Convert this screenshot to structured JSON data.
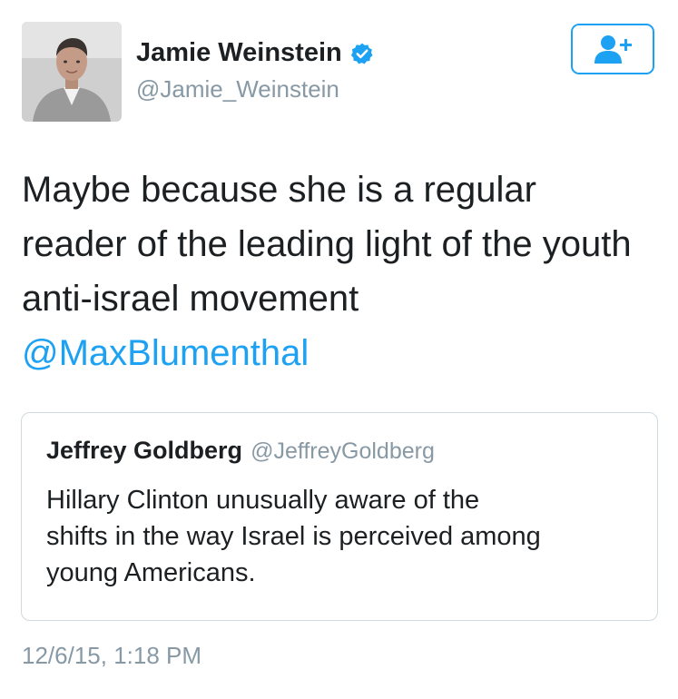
{
  "author": {
    "display_name": "Jamie Weinstein",
    "handle": "@Jamie_Weinstein",
    "verified": true,
    "avatar_icon": "profile-photo"
  },
  "follow_button": {
    "icon": "add-user-icon",
    "color": "#1da1f2"
  },
  "tweet": {
    "text": "Maybe because she is a regular\nreader of the leading light of the youth\nanti-israel movement",
    "mention": "@MaxBlumenthal"
  },
  "quoted_tweet": {
    "display_name": "Jeffrey Goldberg",
    "handle": "@JeffreyGoldberg",
    "text": "Hillary Clinton unusually aware of the\nshifts in the way Israel is perceived among\nyoung Americans."
  },
  "timestamp": "12/6/15, 1:18 PM",
  "colors": {
    "link": "#1da1f2",
    "secondary_text": "#8899a6",
    "border": "#cfd9de"
  }
}
